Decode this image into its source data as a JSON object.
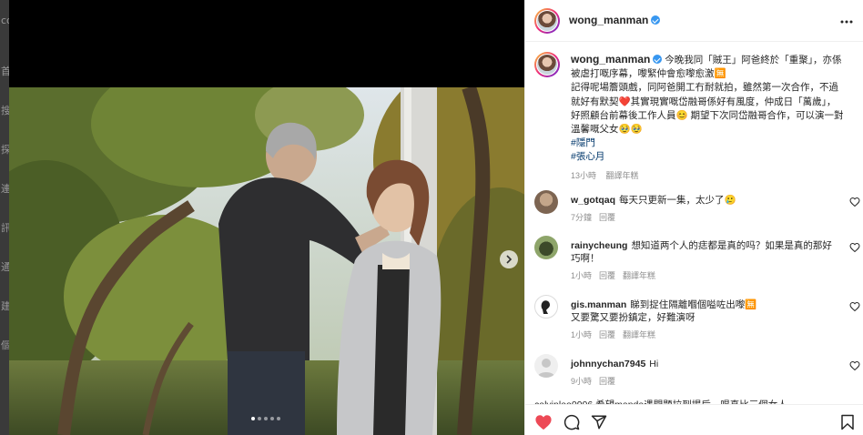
{
  "backdrop": {
    "glyphs": [
      "co",
      "首",
      "搜",
      "探",
      "連",
      "訊",
      "通",
      "建",
      "個"
    ]
  },
  "post": {
    "author": "wong_manman",
    "caption_lines": [
      "今晚我同「賊王」阿爸終於「重聚」，亦係",
      "被虐打嘅序幕，嚟緊仲會愈嚟愈激🈚",
      "記得呢場簷頭戲，同阿爸開工冇耐就拍，雖然第一次合作，不過",
      "就好有默契❤️其實現實嘅岱融哥係好有風度，仲成日「萬歲」，",
      "好照顧台前幕後工作人員😊 期望下次同岱融哥合作，可以演一對",
      "溫馨嘅父女🥹🥹"
    ],
    "hashtags": [
      "#隱門",
      "#張心月"
    ],
    "time": "13小時",
    "translate": "翻譯年糕"
  },
  "comments": [
    {
      "user": "w_gotqaq",
      "lines": [
        "每天只更新一集，太少了🥲"
      ],
      "time": "7分鐘",
      "reply": "回覆",
      "translate": ""
    },
    {
      "user": "rainycheung",
      "lines": [
        "想知道两个人的痣都是真的吗？如果是真的那好",
        "巧啊！"
      ],
      "time": "1小時",
      "reply": "回覆",
      "translate": "翻譯年糕"
    },
    {
      "user": "gis.manman",
      "lines": [
        "睇到捉住隔離嗰個嗌咗出嚟🈚",
        "又要驚又要扮鎮定，好難演呀"
      ],
      "time": "1小時",
      "reply": "回覆",
      "translate": "翻譯年糕"
    },
    {
      "user": "johnnychan7945",
      "lines": [
        "Hi"
      ],
      "time": "9小時",
      "reply": "回覆",
      "translate": ""
    }
  ],
  "peek_text": "calvinleo0906  希望manda遇問題拉到揭后，唱真比三個女人",
  "colors": {
    "like_red": "#ed4956",
    "hashtag": "#00376b",
    "verified": "#3897f0",
    "meta_gray": "#8e8e8e"
  },
  "icons": [
    "verified-icon",
    "more-icon",
    "chevron-right-icon",
    "heart-icon",
    "comment-icon",
    "share-icon",
    "bookmark-icon"
  ],
  "carousel": {
    "count": 5,
    "active": 1
  }
}
